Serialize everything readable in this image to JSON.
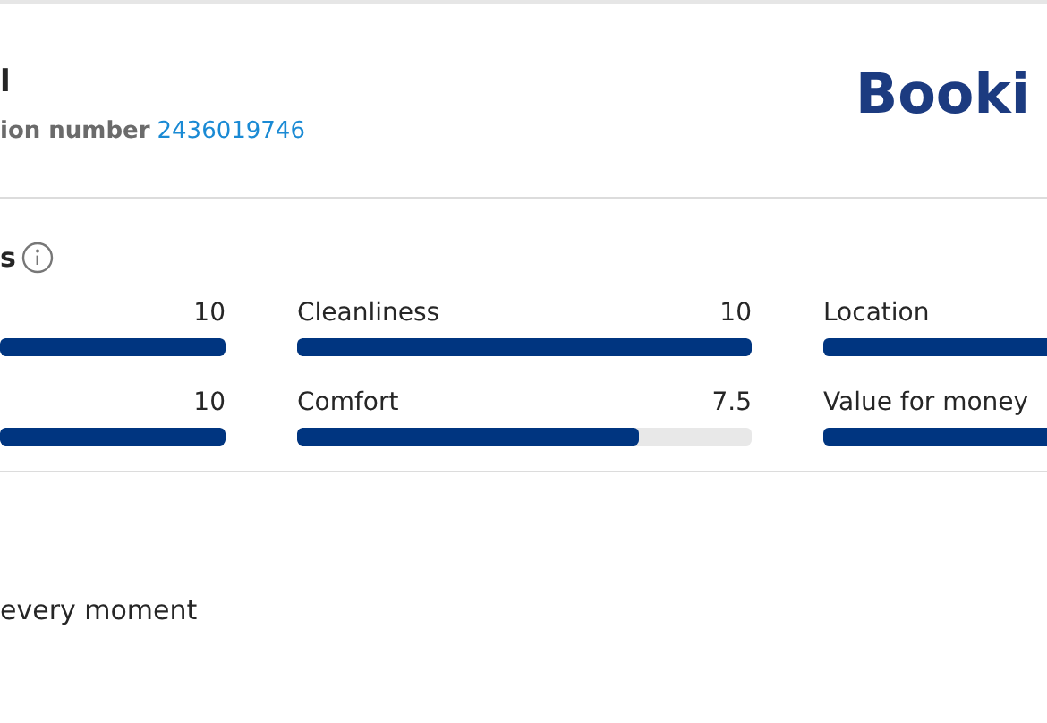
{
  "header": {
    "title": "l",
    "subtitle": "ion number",
    "reservation_link": "2436019746",
    "logo": "Booki"
  },
  "scores": {
    "heading": "s",
    "items": [
      {
        "value": "10",
        "level": 1
      },
      {
        "label": "Cleanliness",
        "value": "10",
        "level": 1
      },
      {
        "label": "Location"
      },
      {
        "value": "10",
        "level": 1
      },
      {
        "label": "Comfort",
        "value": "7.5",
        "level": 0.75
      },
      {
        "label": "Value for money"
      }
    ]
  },
  "footer_text": "every moment"
}
